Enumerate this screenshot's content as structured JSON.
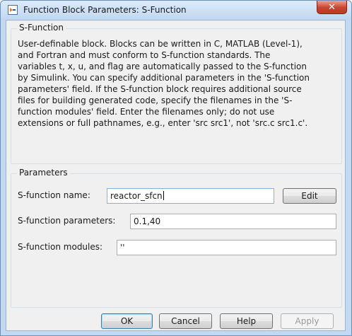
{
  "window": {
    "title": "Function Block Parameters: S-Function",
    "close_glyph": "✕"
  },
  "description_group": {
    "label": "S-Function",
    "text": "User-definable block.  Blocks can be written in C, MATLAB (Level-1),\nand Fortran and must conform to S-function standards.  The\nvariables t, x, u, and flag are automatically passed to the S-function\nby Simulink.  You can specify additional parameters in the 'S-function\nparameters' field. If the S-function block requires additional source\nfiles for building generated code, specify the filenames in the 'S-\nfunction modules' field. Enter the filenames only; do not use\nextensions or full pathnames, e.g., enter 'src src1', not 'src.c src1.c'."
  },
  "parameters_group": {
    "label": "Parameters",
    "name_label": "S-function name:",
    "name_value": "reactor_sfcn",
    "edit_button": "Edit",
    "params_label": "S-function parameters:",
    "params_value": "0.1,40",
    "modules_label": "S-function modules:",
    "modules_value": "''"
  },
  "buttons": {
    "ok": "OK",
    "cancel": "Cancel",
    "help": "Help",
    "apply": "Apply"
  },
  "icons": {
    "app": "simulink-block-icon",
    "close": "close-icon"
  }
}
